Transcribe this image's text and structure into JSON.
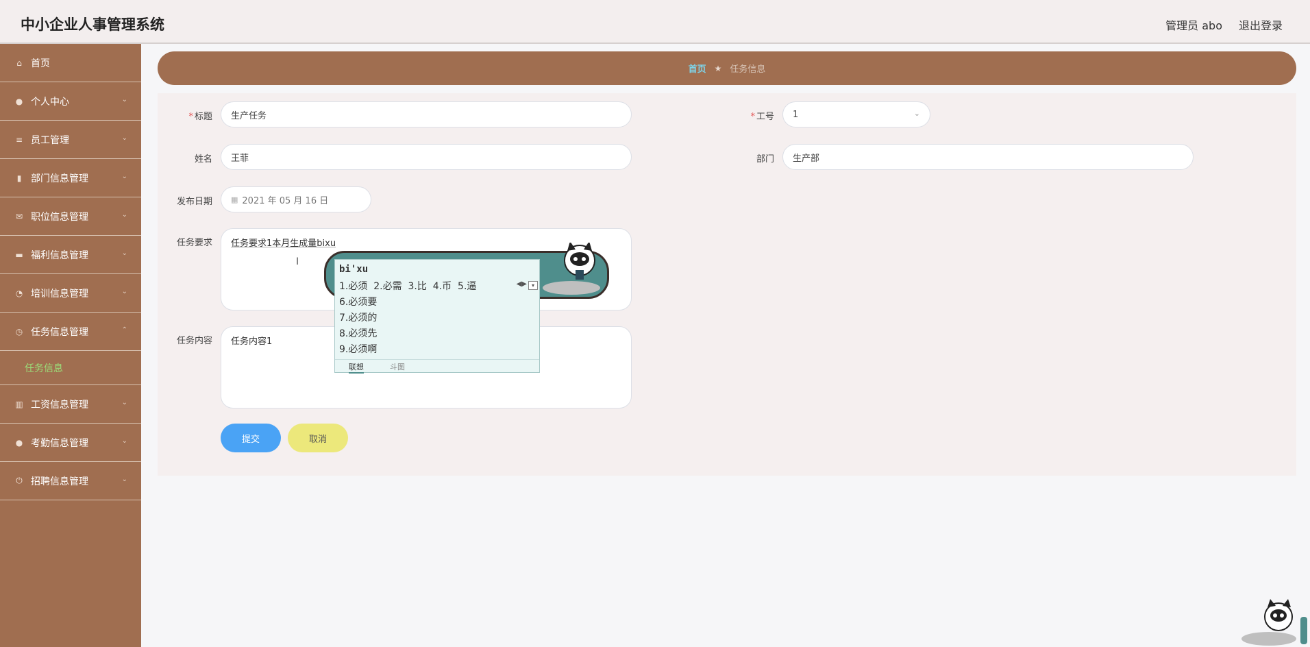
{
  "header": {
    "title": "中小企业人事管理系统",
    "user": "管理员 abo",
    "logout": "退出登录"
  },
  "sidebar": {
    "items": [
      {
        "label": "首页",
        "icon": "home-icon"
      },
      {
        "label": "个人中心",
        "icon": "user-icon"
      },
      {
        "label": "员工管理",
        "icon": "list-icon"
      },
      {
        "label": "部门信息管理",
        "icon": "clipboard-icon"
      },
      {
        "label": "职位信息管理",
        "icon": "mail-icon"
      },
      {
        "label": "福利信息管理",
        "icon": "book-icon"
      },
      {
        "label": "培训信息管理",
        "icon": "gauge-icon"
      },
      {
        "label": "任务信息管理",
        "icon": "clock-icon"
      },
      {
        "label": "工资信息管理",
        "icon": "bar-chart-icon"
      },
      {
        "label": "考勤信息管理",
        "icon": "person-icon"
      },
      {
        "label": "招聘信息管理",
        "icon": "power-icon"
      }
    ],
    "submenu": {
      "label": "任务信息"
    }
  },
  "breadcrumb": {
    "home": "首页",
    "current": "任务信息"
  },
  "form": {
    "title_label": "标题",
    "title_value": "生产任务",
    "jobno_label": "工号",
    "jobno_value": "1",
    "name_label": "姓名",
    "name_value": "王菲",
    "dept_label": "部门",
    "dept_value": "生产部",
    "date_label": "发布日期",
    "date_value": "2021 年 05 月 16 日",
    "req_label": "任务要求",
    "req_value": "任务要求1本月生成量bixu",
    "content_label": "任务内容",
    "content_value": "任务内容1",
    "submit": "提交",
    "cancel": "取消"
  },
  "ime": {
    "pinyin": "bi'xu",
    "first_row": "1.必须  2.必需  3.比  4.币  5.逼",
    "candidates": [
      "6.必须要",
      "7.必须的",
      "8.必须先",
      "9.必须啊"
    ],
    "tabs": [
      "联想",
      "斗图"
    ]
  }
}
